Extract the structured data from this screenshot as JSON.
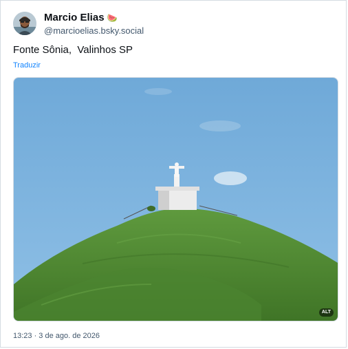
{
  "post": {
    "author_name": "Marcio Elias",
    "author_emoji": "🍉",
    "author_handle": "@marcioelias.bsky.social",
    "text": "Fonte Sônia,  Valinhos SP",
    "translate_label": "Traduzir",
    "timestamp": "13:23 · 3 de ago. de 2026",
    "image": {
      "alt_badge": "ALT",
      "icon": "photo-hill-statue"
    }
  },
  "colors": {
    "link": "#1083fe",
    "muted_text": "#42576c",
    "border": "#d4dbe2",
    "sky": "#7db4de",
    "hill": "#4f8a33"
  }
}
